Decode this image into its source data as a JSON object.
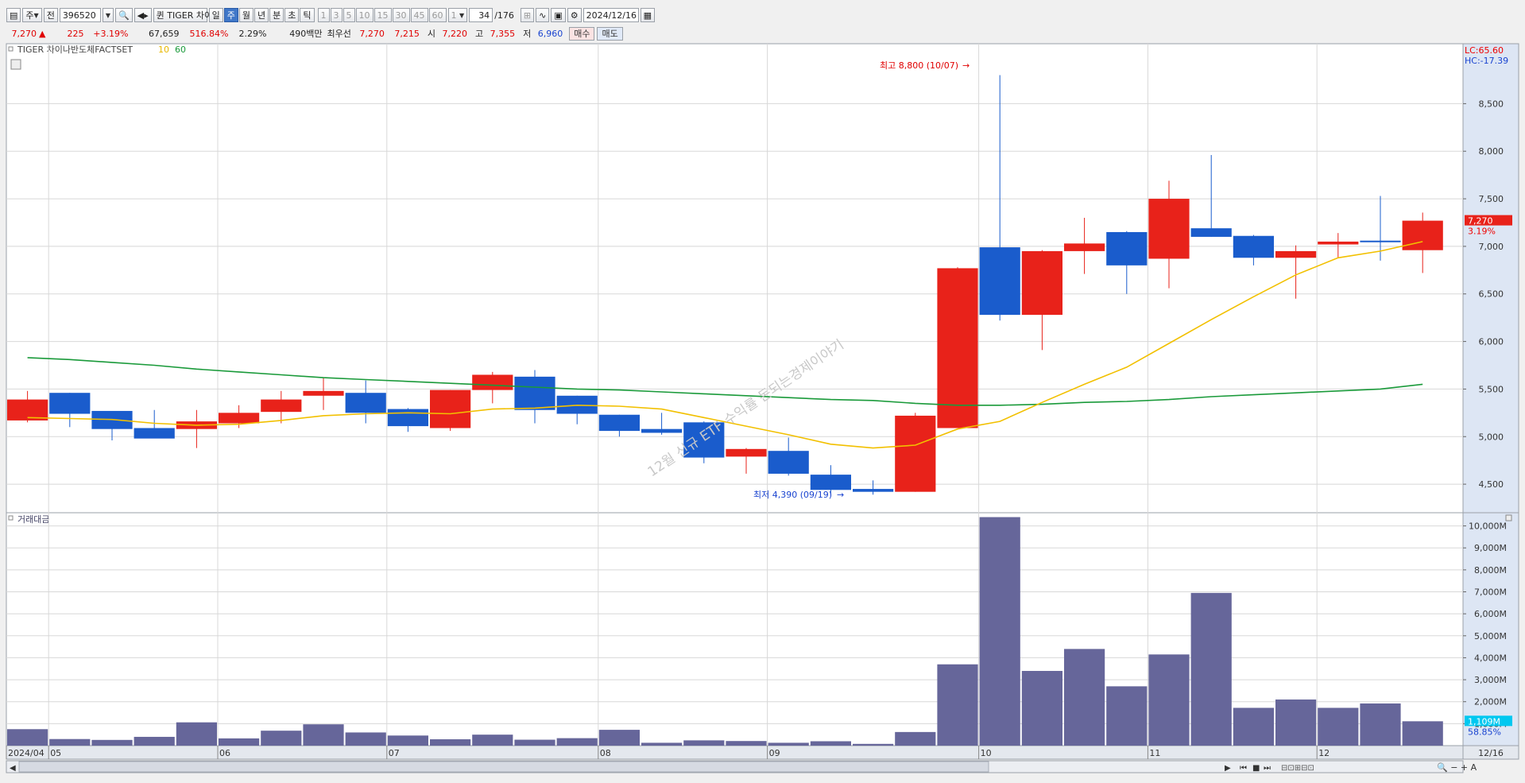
{
  "toolbar": {
    "market": "주",
    "prev": "전",
    "code": "396520",
    "fav": "퀸",
    "name": "TIGER 차이",
    "periods": [
      "일",
      "주",
      "월",
      "년",
      "분",
      "초",
      "틱"
    ],
    "selected_period": "주",
    "intervals": [
      "1",
      "3",
      "5",
      "10",
      "15",
      "30",
      "45",
      "60"
    ],
    "unit": "1",
    "count": "34",
    "total": "/176",
    "date": "2024/12/16"
  },
  "quote": {
    "price": "7,270",
    "arrow": "▲",
    "change": "225",
    "change_pct": "+3.19%",
    "volume": "67,659",
    "vol_ratio": "516.84%",
    "turnover": "2.29%",
    "amount": "490백만",
    "priority_label": "최우선",
    "ask": "7,270",
    "bid": "7,215",
    "open_label": "시",
    "open": "7,220",
    "high_label": "고",
    "high": "7,355",
    "low_label": "저",
    "low": "6,960",
    "buy_label": "매수",
    "sell_label": "매도"
  },
  "price_panel": {
    "legend_name": "TIGER 차이나반도체FACTSET",
    "ma_short_label": "10",
    "ma_long_label": "60",
    "lc_label": "LC:65.60",
    "hc_label": "HC:-17.39",
    "high_annotation": "최고 8,800 (10/07)",
    "low_annotation": "최저 4,390 (09/19)",
    "last_price_label": "7,270",
    "last_pct_label": "3.19%",
    "watermark": "12월 신규 ETF 수익률 돈되는경제이야기"
  },
  "volume_panel": {
    "title": "거래대금",
    "last_label": "1,109M",
    "last_pct_label": "58.85%"
  },
  "colors": {
    "up": "#e8221a",
    "down": "#1a5ccc",
    "ma10": "#f2c000",
    "ma60": "#1a9a3a",
    "volume_bar": "#66669a",
    "grid": "#d8d8d8"
  },
  "chart_data": {
    "type": "candlestick",
    "timeframe": "weekly",
    "price_axis": {
      "ticks": [
        4500,
        5000,
        5500,
        6000,
        6500,
        7000,
        7500,
        8000,
        8500
      ],
      "tick_labels": [
        "4,500",
        "5,000",
        "5,500",
        "6,000",
        "6,500",
        "7,000",
        "7,500",
        "8,000",
        "8,500"
      ],
      "range": [
        4200,
        9130
      ]
    },
    "volume_axis": {
      "ticks": [
        1000,
        2000,
        3000,
        4000,
        5000,
        6000,
        7000,
        8000,
        9000,
        10000
      ],
      "tick_labels": [
        "1,000M",
        "2,000M",
        "3,000M",
        "4,000M",
        "5,000M",
        "6,000M",
        "7,000M",
        "8,000M",
        "9,000M",
        "10,000M"
      ],
      "range": [
        0,
        10600
      ]
    },
    "x_labels": [
      {
        "label": "2024/04",
        "index": 0
      },
      {
        "label": "05",
        "index": 1
      },
      {
        "label": "06",
        "index": 5
      },
      {
        "label": "07",
        "index": 9
      },
      {
        "label": "08",
        "index": 14
      },
      {
        "label": "09",
        "index": 18
      },
      {
        "label": "10",
        "index": 23
      },
      {
        "label": "11",
        "index": 27
      },
      {
        "label": "12",
        "index": 31
      },
      {
        "label": "12/16",
        "index": 34
      }
    ],
    "candles": [
      {
        "o": 5170,
        "h": 5480,
        "l": 5150,
        "c": 5390
      },
      {
        "o": 5460,
        "h": 5460,
        "l": 5100,
        "c": 5240
      },
      {
        "o": 5270,
        "h": 5270,
        "l": 4960,
        "c": 5080
      },
      {
        "o": 5090,
        "h": 5280,
        "l": 4990,
        "c": 4980
      },
      {
        "o": 5080,
        "h": 5280,
        "l": 4880,
        "c": 5160
      },
      {
        "o": 5140,
        "h": 5330,
        "l": 5090,
        "c": 5250
      },
      {
        "o": 5260,
        "h": 5480,
        "l": 5140,
        "c": 5390
      },
      {
        "o": 5430,
        "h": 5620,
        "l": 5280,
        "c": 5480
      },
      {
        "o": 5460,
        "h": 5590,
        "l": 5140,
        "c": 5250
      },
      {
        "o": 5290,
        "h": 5300,
        "l": 5050,
        "c": 5110
      },
      {
        "o": 5090,
        "h": 5490,
        "l": 5060,
        "c": 5490
      },
      {
        "o": 5490,
        "h": 5680,
        "l": 5350,
        "c": 5650
      },
      {
        "o": 5630,
        "h": 5700,
        "l": 5140,
        "c": 5280
      },
      {
        "o": 5430,
        "h": 5430,
        "l": 5130,
        "c": 5240
      },
      {
        "o": 5230,
        "h": 5230,
        "l": 5000,
        "c": 5060
      },
      {
        "o": 5080,
        "h": 5250,
        "l": 5020,
        "c": 5040
      },
      {
        "o": 5150,
        "h": 5160,
        "l": 4720,
        "c": 4780
      },
      {
        "o": 4790,
        "h": 4880,
        "l": 4610,
        "c": 4870
      },
      {
        "o": 4850,
        "h": 4990,
        "l": 4590,
        "c": 4610
      },
      {
        "o": 4600,
        "h": 4700,
        "l": 4390,
        "c": 4440
      },
      {
        "o": 4450,
        "h": 4540,
        "l": 4390,
        "c": 4420
      },
      {
        "o": 4420,
        "h": 5250,
        "l": 4420,
        "c": 5220
      },
      {
        "o": 5090,
        "h": 6780,
        "l": 5090,
        "c": 6770
      },
      {
        "o": 6990,
        "h": 8800,
        "l": 6220,
        "c": 6280
      },
      {
        "o": 6280,
        "h": 6960,
        "l": 5910,
        "c": 6950
      },
      {
        "o": 6950,
        "h": 7300,
        "l": 6710,
        "c": 7030
      },
      {
        "o": 7150,
        "h": 7160,
        "l": 6500,
        "c": 6800
      },
      {
        "o": 6870,
        "h": 7690,
        "l": 6560,
        "c": 7500
      },
      {
        "o": 7190,
        "h": 7960,
        "l": 7100,
        "c": 7100
      },
      {
        "o": 7110,
        "h": 7120,
        "l": 6800,
        "c": 6880
      },
      {
        "o": 6880,
        "h": 7010,
        "l": 6450,
        "c": 6950
      },
      {
        "o": 7020,
        "h": 7140,
        "l": 6880,
        "c": 7050
      },
      {
        "o": 7060,
        "h": 7530,
        "l": 6850,
        "c": 7050
      },
      {
        "o": 6960,
        "h": 7355,
        "l": 6720,
        "c": 7270
      }
    ],
    "ma10": [
      5200,
      5190,
      5180,
      5140,
      5120,
      5130,
      5170,
      5220,
      5240,
      5250,
      5240,
      5290,
      5300,
      5330,
      5320,
      5290,
      5200,
      5110,
      5020,
      4920,
      4880,
      4910,
      5080,
      5160,
      5360,
      5550,
      5730,
      5980,
      6230,
      6470,
      6700,
      6880,
      6950,
      7050
    ],
    "ma60": [
      5830,
      5810,
      5780,
      5750,
      5710,
      5680,
      5650,
      5620,
      5600,
      5580,
      5560,
      5540,
      5520,
      5500,
      5490,
      5470,
      5450,
      5430,
      5410,
      5390,
      5380,
      5350,
      5330,
      5330,
      5340,
      5360,
      5370,
      5390,
      5420,
      5440,
      5460,
      5480,
      5500,
      5550
    ],
    "volume_m": [
      750,
      300,
      260,
      400,
      1060,
      330,
      680,
      970,
      600,
      460,
      290,
      500,
      270,
      340,
      720,
      130,
      240,
      210,
      130,
      200,
      80,
      620,
      3700,
      10400,
      3400,
      4400,
      2700,
      4150,
      6950,
      1720,
      2100,
      1720,
      1920,
      1109
    ]
  }
}
